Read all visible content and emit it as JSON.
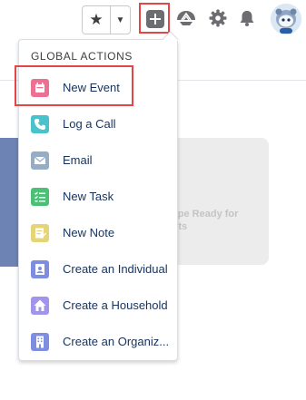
{
  "header": {
    "favorites_star_icon": "star-icon",
    "favorites_menu_icon": "chevron-down-icon",
    "global_actions_icon": "add-icon",
    "help_icon": "trailhead-icon",
    "setup_icon": "gear-icon",
    "notifications_icon": "bell-icon",
    "avatar_icon": "astro-avatar"
  },
  "background": {
    "card_text": "lope Ready for\nerts"
  },
  "menu": {
    "heading": "GLOBAL ACTIONS",
    "items": [
      {
        "label": "New Event",
        "icon": "event-icon",
        "color": "#eb7092"
      },
      {
        "label": "Log a Call",
        "icon": "call-icon",
        "color": "#48c3cc"
      },
      {
        "label": "Email",
        "icon": "email-icon",
        "color": "#95aec5"
      },
      {
        "label": "New Task",
        "icon": "task-icon",
        "color": "#4bc076"
      },
      {
        "label": "New Note",
        "icon": "note-icon",
        "color": "#e6d478"
      },
      {
        "label": "Create an Individual",
        "icon": "individual-icon",
        "color": "#7f8de1"
      },
      {
        "label": "Create a Household",
        "icon": "household-icon",
        "color": "#a094ed"
      },
      {
        "label": "Create an Organiz...",
        "icon": "organization-icon",
        "color": "#7f8de1"
      }
    ]
  },
  "colors": {
    "highlight": "#e24646",
    "text": "#16325c"
  }
}
